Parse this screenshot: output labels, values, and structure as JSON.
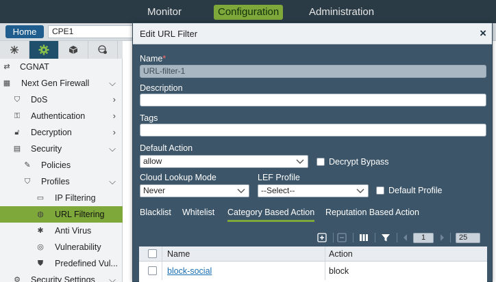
{
  "topnav": {
    "items": [
      {
        "label": "Monitor"
      },
      {
        "label": "Configuration"
      },
      {
        "label": "Administration"
      }
    ]
  },
  "subbar": {
    "home_label": "Home",
    "device_value": "CPE1"
  },
  "sidebar": {
    "items": [
      {
        "label": "CGNAT"
      },
      {
        "label": "Next Gen Firewall"
      },
      {
        "label": "DoS"
      },
      {
        "label": "Authentication"
      },
      {
        "label": "Decryption"
      },
      {
        "label": "Security"
      },
      {
        "label": "Policies"
      },
      {
        "label": "Profiles"
      },
      {
        "label": "IP Filtering"
      },
      {
        "label": "URL Filtering"
      },
      {
        "label": "Anti Virus"
      },
      {
        "label": "Vulnerability"
      },
      {
        "label": "Predefined Vul..."
      },
      {
        "label": "Security Settings"
      }
    ]
  },
  "modal": {
    "title": "Edit URL Filter",
    "close_icon": "×",
    "name_label": "Name",
    "required_mark": "*",
    "name_value": "URL-filter-1",
    "description_label": "Description",
    "description_value": "",
    "tags_label": "Tags",
    "tags_value": "",
    "default_action_label": "Default Action",
    "default_action_value": "allow",
    "decrypt_bypass_label": "Decrypt Bypass",
    "cloud_lookup_label": "Cloud Lookup Mode",
    "cloud_lookup_value": "Never",
    "lef_profile_label": "LEF Profile",
    "lef_profile_value": "--Select--",
    "default_profile_label": "Default Profile",
    "tabs": [
      {
        "label": "Blacklist"
      },
      {
        "label": "Whitelist"
      },
      {
        "label": "Category Based Action"
      },
      {
        "label": "Reputation Based Action"
      }
    ],
    "pager": {
      "page": "1",
      "page_size": "25"
    },
    "grid": {
      "columns": [
        "Name",
        "Action"
      ],
      "rows": [
        {
          "name": "block-social",
          "action": "block"
        }
      ]
    }
  }
}
